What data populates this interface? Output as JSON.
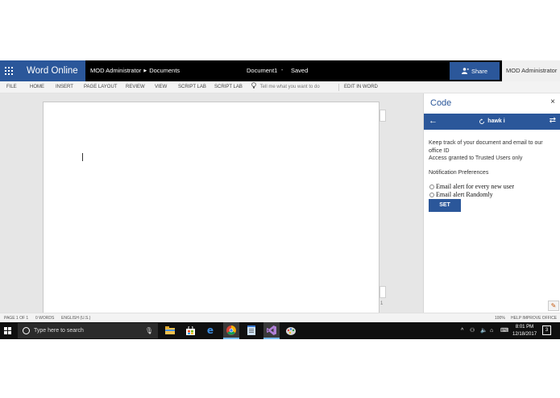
{
  "titlebar": {
    "app_name": "Word Online",
    "breadcrumb_user": "MOD Administrator",
    "breadcrumb_folder": "Documents",
    "document_name": "Document1",
    "separator": "-",
    "save_status": "Saved",
    "share_label": "Share",
    "account_name": "MOD Administrator"
  },
  "ribbon": {
    "file": "FILE",
    "home": "HOME",
    "insert": "INSERT",
    "page_layout": "PAGE LAYOUT",
    "review": "REVIEW",
    "view": "VIEW",
    "script_lab_1": "SCRIPT LAB",
    "script_lab_2": "SCRIPT LAB",
    "tell_me": "Tell me what you want to do",
    "edit_in_word": "EDIT IN WORD"
  },
  "document": {
    "page_number": "1"
  },
  "pane": {
    "title": "Code",
    "close": "×",
    "header_title": "hawk i",
    "description_line1": "Keep track of your document and email to our office ID",
    "description_line2": "Access granted to Trusted Users only",
    "prefs_heading": "Notification Preferences",
    "option_new_user": "Email alert for every new user",
    "option_random": "Email alert Randomly",
    "set_label": "SET"
  },
  "statusbar": {
    "page": "PAGE 1 OF 1",
    "words": "0 WORDS",
    "language": "ENGLISH (U.S.)",
    "zoom": "100%",
    "help": "HELP IMPROVE OFFICE"
  },
  "taskbar": {
    "search_placeholder": "Type here to search",
    "time": "8:01 PM",
    "date": "12/18/2017",
    "notification_count": "3"
  },
  "colors": {
    "accent": "#2b579a",
    "titlebar_bg": "#000000",
    "taskbar_bg": "#101010"
  }
}
